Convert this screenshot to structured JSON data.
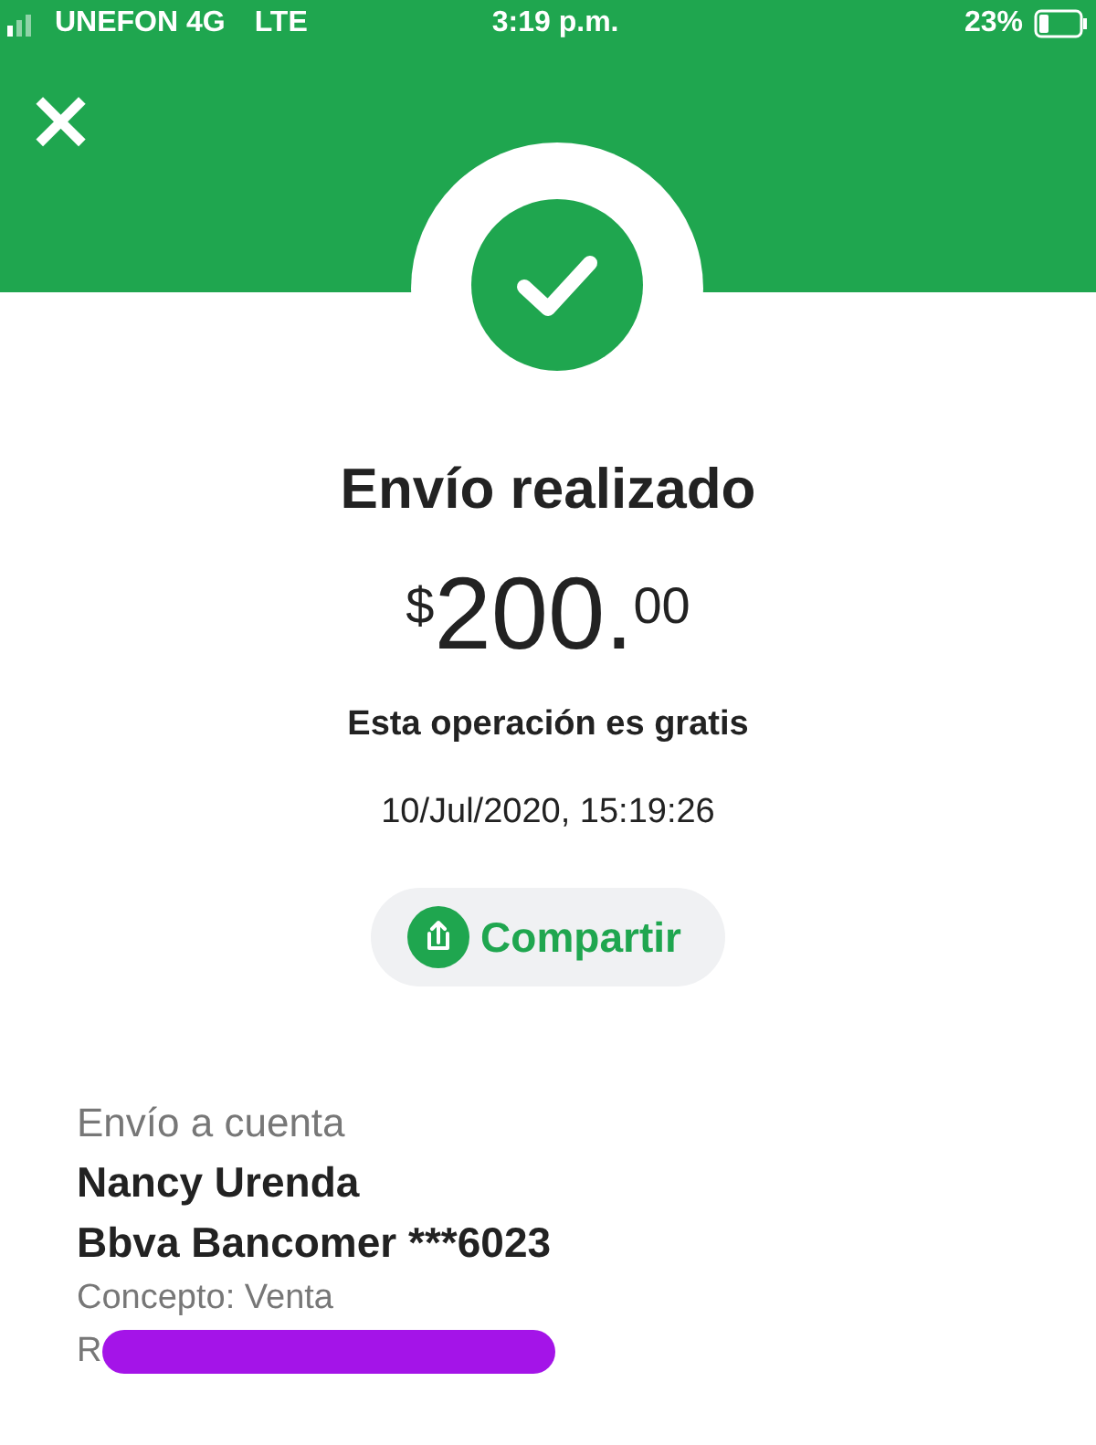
{
  "status_bar": {
    "carrier": "UNEFON 4G",
    "network": "LTE",
    "time": "3:19 p.m.",
    "battery": "23%"
  },
  "close": "×",
  "title": "Envío realizado",
  "amount": {
    "currency": "$",
    "whole": "200.",
    "cents": "00"
  },
  "fee_note": "Esta operación es gratis",
  "datetime": "10/Jul/2020, 15:19:26",
  "share_button": "Compartir",
  "details": {
    "type": "Envío a cuenta",
    "name": "Nancy Urenda",
    "bank": "Bbva Bancomer ***6023",
    "concept": "Concepto: Venta",
    "reference": "R",
    "redacted": true
  }
}
